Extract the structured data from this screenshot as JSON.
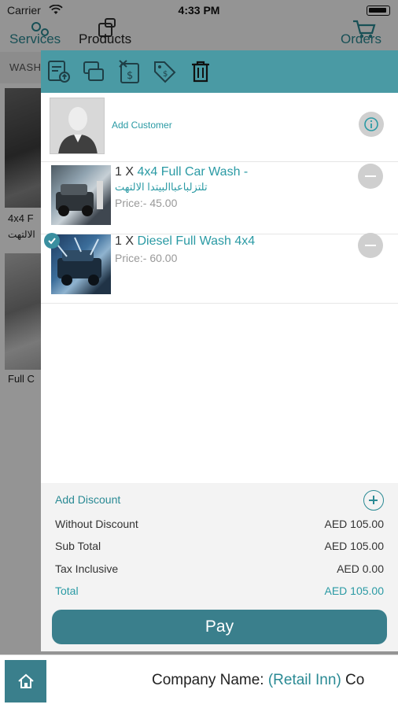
{
  "status_bar": {
    "carrier": "Carrier",
    "time": "4:33 PM"
  },
  "top_nav": {
    "services": "Services",
    "products": "Products",
    "orders": "Orders"
  },
  "category_bar": {
    "label": "WASH"
  },
  "background_tiles": [
    {
      "label": "4x4 F",
      "sub_label": "الالتهت"
    },
    {
      "label": "Full C"
    }
  ],
  "customer": {
    "add_label": "Add Customer"
  },
  "order_items": [
    {
      "quantity": "1 X",
      "name": "4x4 Full Car Wash -",
      "name_ar": "تلتزلباعباالبيتدا الالتهت",
      "price": "Price:- 45.00",
      "checked": false
    },
    {
      "quantity": "1 X",
      "name": "Diesel Full Wash 4x4",
      "price": "Price:- 60.00",
      "checked": true
    }
  ],
  "summary": {
    "add_discount": "Add Discount",
    "without_discount_label": "Without Discount",
    "without_discount_value": "AED 105.00",
    "sub_total_label": "Sub Total",
    "sub_total_value": "AED 105.00",
    "tax_label": "Tax Inclusive",
    "tax_value": "AED 0.00",
    "total_label": "Total",
    "total_value": "AED 105.00"
  },
  "pay_label": "Pay",
  "bottom_bar": {
    "company_label": "Company Name:",
    "company_value": "(Retail Inn)",
    "trailing": "Co"
  },
  "colors": {
    "accent": "#2a9aa4",
    "toolbar": "#4a9aa4",
    "button": "#3a7f8c"
  },
  "icons": {
    "toolbar": [
      "invoice-upload-icon",
      "transfer-icon",
      "cash-cut-icon",
      "tag-discount-icon",
      "trash-icon"
    ],
    "nav": [
      "services-icon",
      "products-icon",
      "orders-cart-icon"
    ]
  }
}
